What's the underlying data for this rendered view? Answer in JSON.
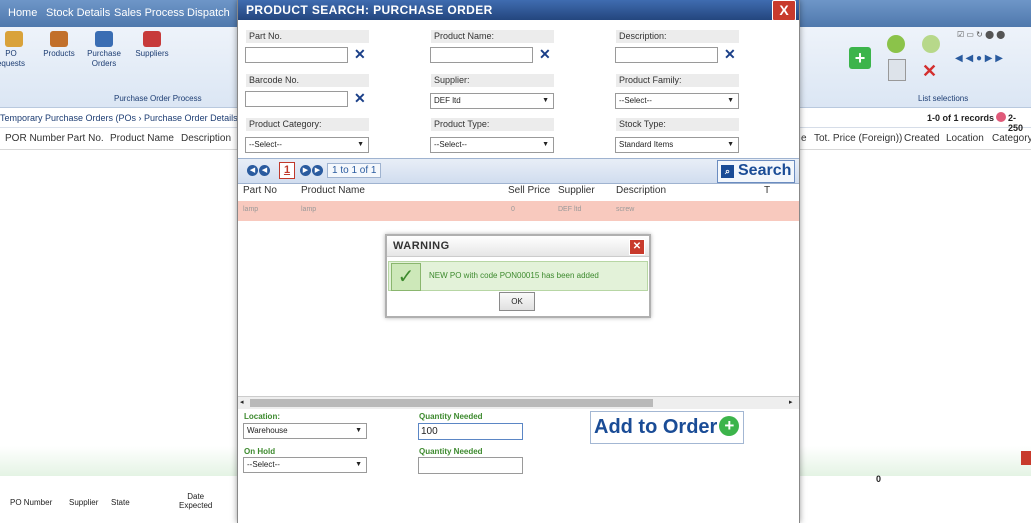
{
  "nav": {
    "items": [
      "Home",
      "Stock Details",
      "Sales Process",
      "Dispatch"
    ]
  },
  "ribbon": {
    "items": [
      "PO\nequests",
      "Products",
      "Purchase\nOrders",
      "Suppliers"
    ],
    "group_label": "Purchase Order Process",
    "list_label": "List selections"
  },
  "background": {
    "breadcrumb": "Temporary Purchase Orders (POs › Purchase Order Details",
    "records": "1-0 of 1 records",
    "records_extra": "2-250",
    "columns_left": [
      "POR Number",
      "Part No.",
      "Product Name",
      "Description"
    ],
    "columns_right": [
      "Tot. Price (Foreign))",
      "Created",
      "Location",
      "Category"
    ],
    "column_right_first": "e",
    "bottom_columns": [
      "PO Number",
      "Supplier",
      "State",
      "Date\nExpected"
    ],
    "bottom_value": "0"
  },
  "modal": {
    "title": "PRODUCT SEARCH: PURCHASE ORDER",
    "close_label": "X",
    "fields": {
      "part_no": "Part No.",
      "product_name": "Product Name:",
      "description": "Description:",
      "barcode_no": "Barcode No.",
      "supplier": "Supplier:",
      "supplier_value": "DEF ltd",
      "product_family": "Product Family:",
      "product_family_value": "--Select--",
      "product_category": "Product Category:",
      "product_category_value": "--Select--",
      "product_type": "Product Type:",
      "product_type_value": "--Select--",
      "stock_type": "Stock Type:",
      "stock_type_value": "Standard Items"
    },
    "pager": {
      "current_page": "1",
      "range": "1 to 1 of 1",
      "search_label": "Search"
    },
    "results": {
      "headers": [
        "Part No",
        "Product Name",
        "Sell Price",
        "Supplier",
        "Description",
        "T"
      ],
      "rows": [
        {
          "part_no": "lamp",
          "product_name": "lamp",
          "sell_price": "0",
          "supplier": "DEF ltd",
          "description": "screw"
        }
      ]
    },
    "bottom": {
      "location_label": "Location:",
      "location_value": "Warehouse",
      "quantity_label": "Quantity Needed",
      "quantity_value": "100",
      "on_hold_label": "On Hold",
      "on_hold_value": "--Select--",
      "quantity_label_2": "Quantity Needed",
      "add_label": "Add to Order"
    }
  },
  "warning": {
    "title": "WARNING",
    "message": "NEW PO with code PON00015 has been added",
    "ok_label": "OK"
  },
  "colors": {
    "accent": "#24467e",
    "brand_blue": "#1a4c96",
    "row_highlight": "#f8c9be",
    "green": "#3d8a2e",
    "close_red": "#c83a2c"
  }
}
